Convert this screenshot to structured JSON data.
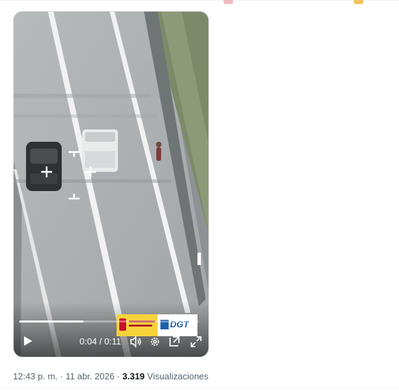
{
  "video": {
    "current_time": "0:04",
    "duration": "0:11",
    "time_separator": " / ",
    "progress": 0.36,
    "watermark_text": "DGT"
  },
  "post": {
    "time": "12:43 p. m.",
    "dot1": " · ",
    "date": "11 abr. 2026",
    "dot2": " · ",
    "views_count": "3.319",
    "views_label": " Visualizaciones"
  },
  "icons": {
    "play": "play-icon",
    "volume": "volume-icon",
    "settings": "gear-icon",
    "pip": "picture-in-picture-icon",
    "fullscreen": "fullscreen-icon"
  },
  "colors": {
    "meta_text": "#536471",
    "strong_text": "#0f1419",
    "dgt_blue": "#1d5fb0"
  }
}
